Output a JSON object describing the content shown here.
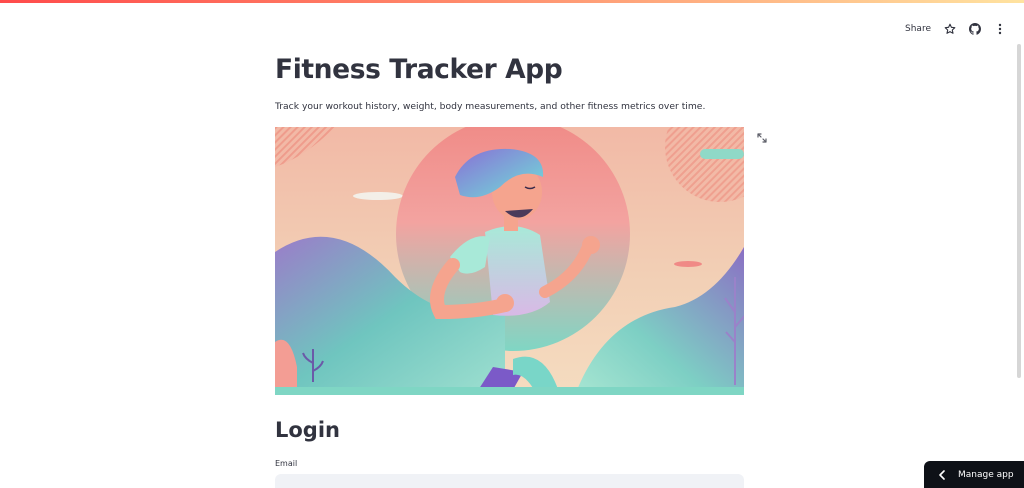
{
  "header": {
    "share_label": "Share",
    "icons": [
      "star-icon",
      "github-icon",
      "more-vertical-icon"
    ]
  },
  "main": {
    "title": "Fitness Tracker App",
    "subtitle": "Track your workout history, weight, body measurements, and other fitness metrics over time.",
    "hero_image": "running-person-illustration"
  },
  "login": {
    "title": "Login",
    "email_label": "Email",
    "email_value": ""
  },
  "footer": {
    "manage_app_label": "Manage app"
  },
  "colors": {
    "accent": "#ff4b4b",
    "text": "#31333f",
    "input_bg": "#f0f2f6",
    "manage_bg": "#0e1117"
  }
}
